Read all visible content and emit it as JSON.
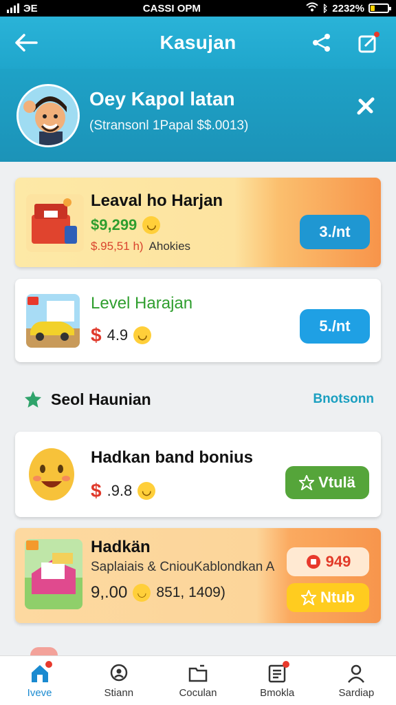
{
  "status_bar": {
    "carrier": "ЭЕ",
    "time": "CASSI OPM",
    "battery": "2232%",
    "battery_level": 0.25
  },
  "header": {
    "title": "Kasujan"
  },
  "profile": {
    "name": "Oey Kapol latan",
    "subtitle": "(Stransonl 1Papal $$.0013)"
  },
  "cards": [
    {
      "title": "Leaval ho Harjan",
      "price": "$9,299",
      "sub": "$.95,51 h)",
      "sub2": "Ahokies",
      "button": "3./nt"
    },
    {
      "title": "Level Harajan",
      "price": "$",
      "value": "4.9",
      "button": "5./nt"
    },
    {
      "title": "Hadkan band bonius",
      "price": "$",
      "value": ".9.8",
      "button": "Vtulä"
    },
    {
      "title": "Hadkän",
      "desc": "Saplaiais & CniouKablondkan A",
      "price": "9,.00",
      "value2": "851, 1409)",
      "button1": "949",
      "button2": "Ntub"
    }
  ],
  "section": {
    "title": "Seol Haunian",
    "link": "Bnotsonn"
  },
  "nav": [
    {
      "label": "Iveve",
      "icon": "home-icon"
    },
    {
      "label": "Stiann",
      "icon": "search-person-icon"
    },
    {
      "label": "Coculan",
      "icon": "folder-icon"
    },
    {
      "label": "Bmokla",
      "icon": "document-icon"
    },
    {
      "label": "Sardiap",
      "icon": "user-icon"
    }
  ],
  "colors": {
    "accent": "#1fa6cc",
    "orange": "#f7944a",
    "green": "#55a53a",
    "blue": "#1f97d2"
  }
}
